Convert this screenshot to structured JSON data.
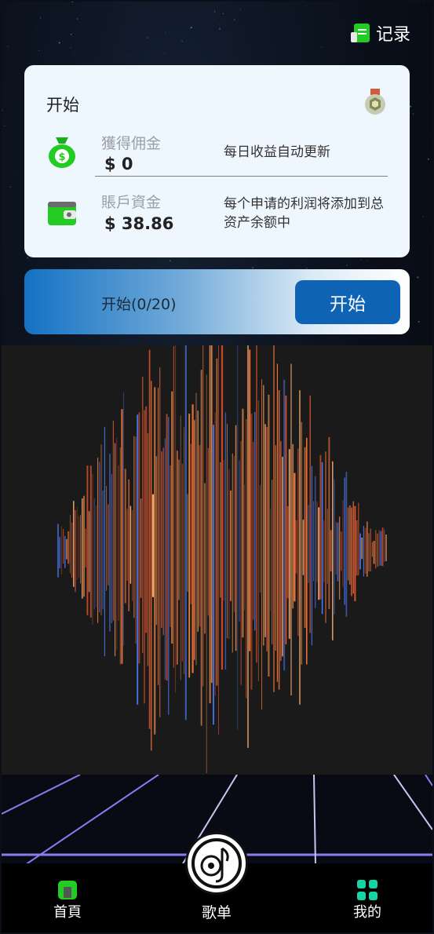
{
  "header": {
    "record_label": "记录"
  },
  "card": {
    "title": "开始",
    "commission": {
      "label": "獲得佣金",
      "value": "$ 0",
      "note": "每日收益自动更新"
    },
    "balance": {
      "label": "賬戶資金",
      "value": "$ 38.86",
      "note": "每个申请的利润将添加到总资产余额中"
    }
  },
  "start_bar": {
    "progress_text": "开始(0/20)",
    "button_label": "开始"
  },
  "nav": {
    "home_label": "首頁",
    "playlist_label": "歌单",
    "mine_label": "我的"
  },
  "colors": {
    "accent_blue": "#0e63b5",
    "green": "#22cc22",
    "teal": "#17d4a4",
    "grid_purple": "#8a7cf0"
  },
  "icons": {
    "record": "document-green-icon",
    "commission": "money-bag-icon",
    "balance": "wallet-icon",
    "badge": "medal-badge-icon",
    "home": "home-cube-icon",
    "playlist": "music-disc-icon",
    "mine": "grid-four-icon"
  }
}
